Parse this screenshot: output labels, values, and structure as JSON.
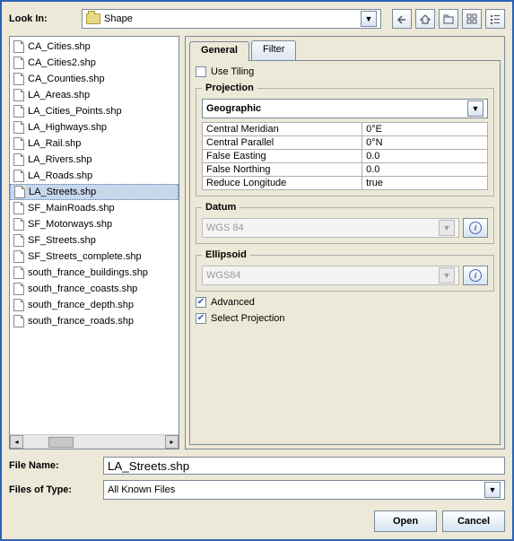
{
  "lookin": {
    "label": "Look In:",
    "value": "Shape"
  },
  "toolbar_icons": [
    "up-one-level-icon",
    "home-icon",
    "new-folder-icon",
    "list-view-icon",
    "details-view-icon"
  ],
  "files": [
    "CA_Cities.shp",
    "CA_Cities2.shp",
    "CA_Counties.shp",
    "LA_Areas.shp",
    "LA_Cities_Points.shp",
    "LA_Highways.shp",
    "LA_Rail.shp",
    "LA_Rivers.shp",
    "LA_Roads.shp",
    "LA_Streets.shp",
    "SF_MainRoads.shp",
    "SF_Motorways.shp",
    "SF_Streets.shp",
    "SF_Streets_complete.shp",
    "south_france_buildings.shp",
    "south_france_coasts.shp",
    "south_france_depth.shp",
    "south_france_roads.shp"
  ],
  "selected_file_index": 9,
  "tabs": {
    "general": "General",
    "filter": "Filter"
  },
  "use_tiling": {
    "label": "Use Tiling",
    "checked": false
  },
  "projection": {
    "legend": "Projection",
    "value": "Geographic",
    "params": [
      {
        "name": "Central Meridian",
        "value": "0°E"
      },
      {
        "name": "Central Parallel",
        "value": "0°N"
      },
      {
        "name": "False Easting",
        "value": "0.0"
      },
      {
        "name": "False Northing",
        "value": "0.0"
      },
      {
        "name": "Reduce Longitude",
        "value": "true"
      }
    ]
  },
  "datum": {
    "legend": "Datum",
    "value": "WGS 84"
  },
  "ellipsoid": {
    "legend": "Ellipsoid",
    "value": "WGS84"
  },
  "advanced": {
    "label": "Advanced",
    "checked": true
  },
  "select_projection": {
    "label": "Select Projection",
    "checked": true
  },
  "filename": {
    "label": "File Name:",
    "value": "LA_Streets.shp"
  },
  "filetype": {
    "label": "Files of Type:",
    "value": "All Known Files"
  },
  "buttons": {
    "open": "Open",
    "cancel": "Cancel"
  }
}
